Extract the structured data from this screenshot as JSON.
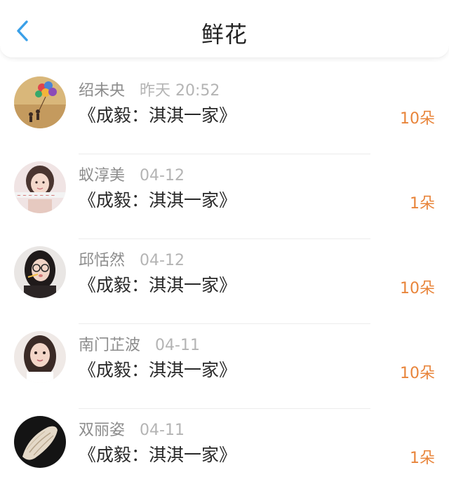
{
  "header": {
    "title": "鲜花",
    "back_icon": "chevron-left-icon",
    "accent_color": "#3aa0e8"
  },
  "items": [
    {
      "user": "绍未央",
      "time": "昨天 20:52",
      "work": "《成毅：淇淇一家》",
      "flowers": "10朵",
      "avatar_icon": "balloon-avatar-icon"
    },
    {
      "user": "蚁淳美",
      "time": "04-12",
      "work": "《成毅：淇淇一家》",
      "flowers": "1朵",
      "avatar_icon": "girl-avatar-icon"
    },
    {
      "user": "邱恬然",
      "time": "04-12",
      "work": "《成毅：淇淇一家》",
      "flowers": "10朵",
      "avatar_icon": "glasses-girl-avatar-icon"
    },
    {
      "user": "南门芷波",
      "time": "04-11",
      "work": "《成毅：淇淇一家》",
      "flowers": "10朵",
      "avatar_icon": "girl-avatar-icon"
    },
    {
      "user": "双丽姿",
      "time": "04-11",
      "work": "《成毅：淇淇一家》",
      "flowers": "1朵",
      "avatar_icon": "shell-avatar-icon"
    }
  ],
  "colors": {
    "count": "#e8843a",
    "name": "#8c8c8c",
    "time": "#b4b4b4"
  }
}
